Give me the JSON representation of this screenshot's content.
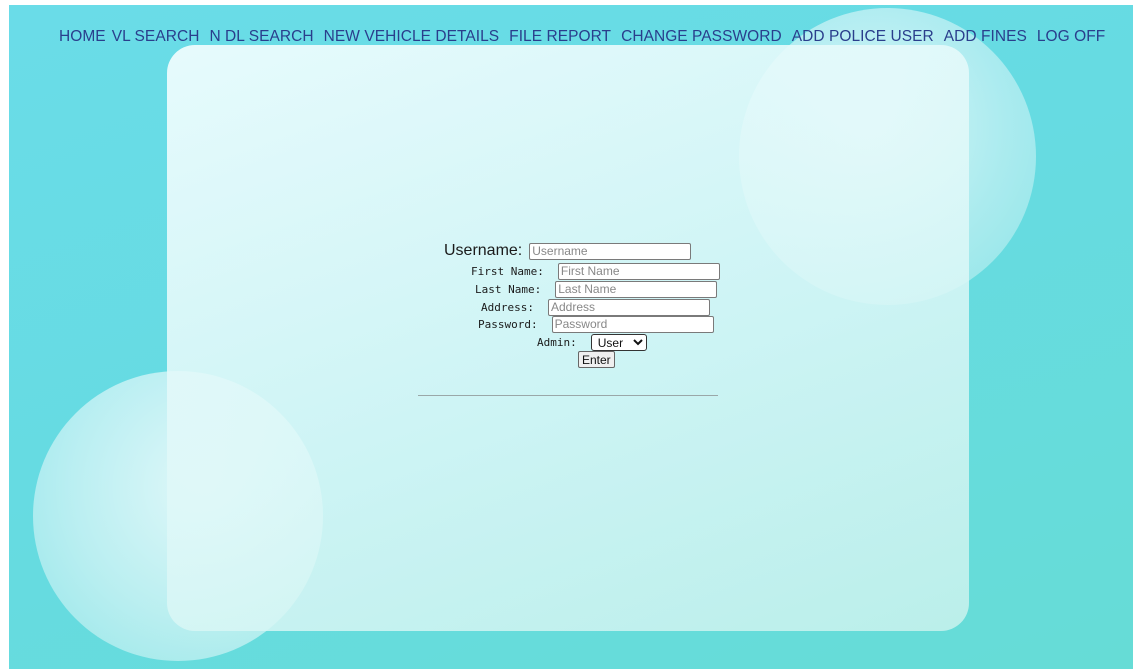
{
  "nav": {
    "items": [
      {
        "label": "HOME"
      },
      {
        "label": "VL SEARCH"
      },
      {
        "label": "N DL SEARCH"
      },
      {
        "label": "NEW VEHICLE DETAILS"
      },
      {
        "label": "FILE REPORT"
      },
      {
        "label": "CHANGE PASSWORD"
      },
      {
        "label": "ADD POLICE USER"
      },
      {
        "label": "ADD FINES"
      },
      {
        "label": "LOG OFF"
      }
    ]
  },
  "form": {
    "username_label": "Username:",
    "username_placeholder": "Username",
    "firstname_label": "First Name:",
    "firstname_placeholder": "First Name",
    "lastname_label": "Last Name:",
    "lastname_placeholder": "Last Name",
    "address_label": "Address:",
    "address_placeholder": "Address",
    "password_label": "Password:",
    "password_placeholder": "Password",
    "admin_label": "Admin:",
    "admin_selected": "User",
    "enter_label": "Enter"
  },
  "colors": {
    "nav_text": "#2a3e8c",
    "background": "#66dbe2"
  }
}
